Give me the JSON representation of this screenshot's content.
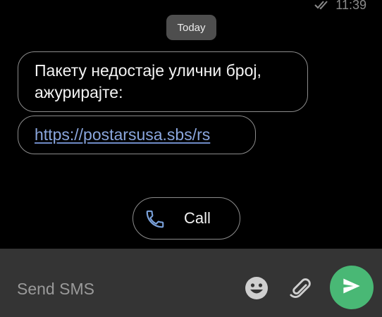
{
  "status_bar": {
    "time": "11:39"
  },
  "conversation": {
    "date_chip": "Today",
    "messages": [
      {
        "text": "Пакету недостаје улични број, ажурирајте:"
      },
      {
        "link": "https://postarsusa.sbs/rs"
      }
    ],
    "call_button": {
      "label": "Call",
      "icon": "phone-icon"
    }
  },
  "composer": {
    "placeholder": "Send SMS",
    "value": "",
    "icons": [
      "emoji-icon",
      "attach-icon",
      "send-icon"
    ],
    "send_color": "#49b875"
  },
  "colors": {
    "background": "#000000",
    "link": "#8aa6dd",
    "call_icon": "#7ba3dd",
    "composer_background": "#343434"
  }
}
